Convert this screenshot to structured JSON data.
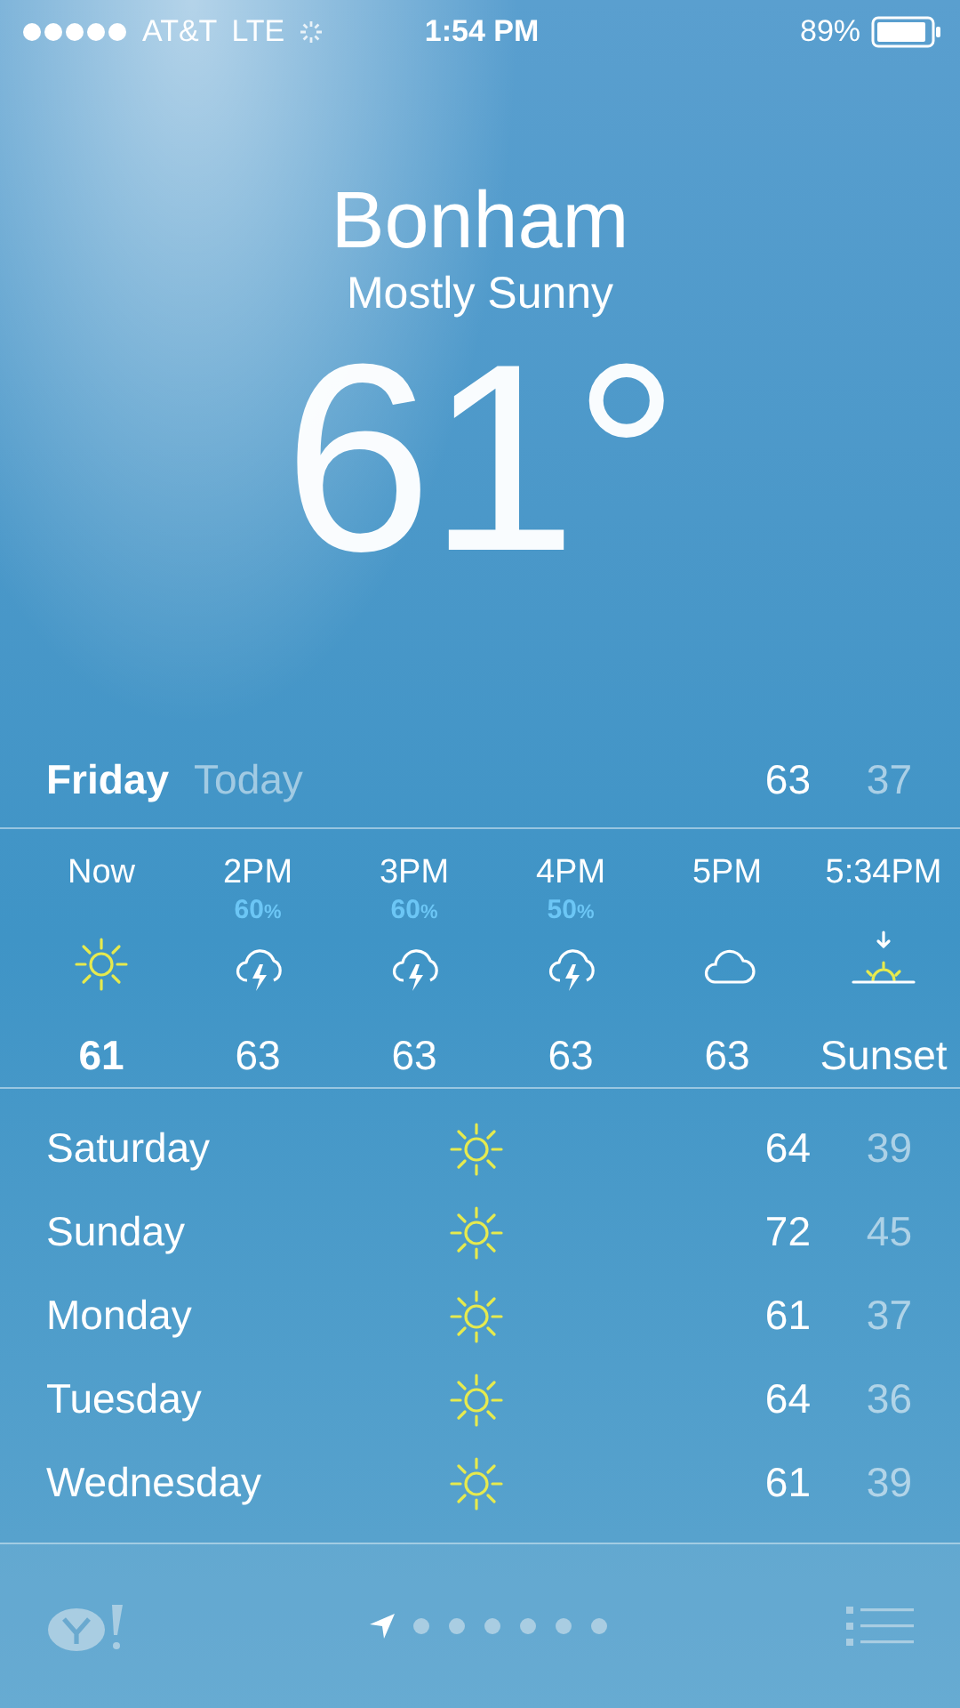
{
  "status_bar": {
    "carrier": "AT&T",
    "network": "LTE",
    "time": "1:54 PM",
    "battery": "89%"
  },
  "header": {
    "city": "Bonham",
    "condition": "Mostly Sunny",
    "temperature": "61°"
  },
  "today": {
    "day": "Friday",
    "label": "Today",
    "high": "63",
    "low": "37"
  },
  "hourly": [
    {
      "time": "Now",
      "kind": "sun",
      "temp": "61",
      "current": true
    },
    {
      "time": "2PM",
      "kind": "storm",
      "precip": "60",
      "precip_unit": "%",
      "temp": "63",
      "current": false
    },
    {
      "time": "3PM",
      "kind": "storm",
      "precip": "60",
      "precip_unit": "%",
      "temp": "63",
      "current": false
    },
    {
      "time": "4PM",
      "kind": "storm",
      "precip": "50",
      "precip_unit": "%",
      "temp": "63",
      "current": false
    },
    {
      "time": "5PM",
      "kind": "cloud",
      "temp": "63",
      "current": false
    },
    {
      "time": "5:34PM",
      "kind": "sunset",
      "temp": "Sunset",
      "current": false
    }
  ],
  "daily": [
    {
      "day": "Saturday",
      "kind": "sun",
      "high": "64",
      "low": "39"
    },
    {
      "day": "Sunday",
      "kind": "sun",
      "high": "72",
      "low": "45"
    },
    {
      "day": "Monday",
      "kind": "sun",
      "high": "61",
      "low": "37"
    },
    {
      "day": "Tuesday",
      "kind": "sun",
      "high": "64",
      "low": "36"
    },
    {
      "day": "Wednesday",
      "kind": "sun",
      "high": "61",
      "low": "39"
    }
  ],
  "pages": [
    {
      "kind": "location",
      "selected": true
    },
    {
      "kind": "dot",
      "selected": false
    },
    {
      "kind": "dot",
      "selected": false
    },
    {
      "kind": "dot",
      "selected": false
    },
    {
      "kind": "dot",
      "selected": false
    },
    {
      "kind": "dot",
      "selected": false
    },
    {
      "kind": "dot",
      "selected": false
    }
  ]
}
